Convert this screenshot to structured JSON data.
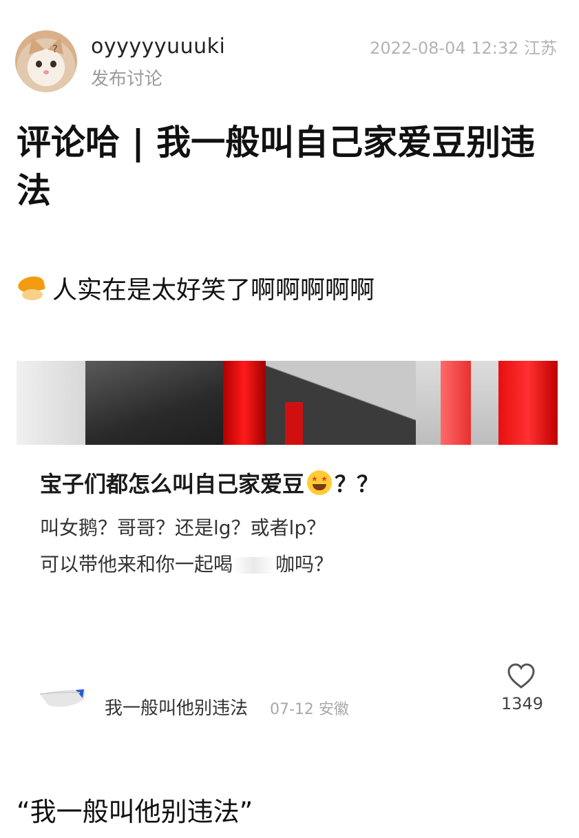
{
  "post": {
    "username": "oyyyyyuuuki",
    "subtitle": "发布讨论",
    "datetime_location": "2022-08-04 12:32 江苏",
    "title": "评论哈 | 我一般叫自己家爱豆别违法",
    "body": "人实在是太好笑了啊啊啊啊啊"
  },
  "screenshot": {
    "question_title": "宝子们都怎么叫自己家爱豆",
    "question_suffix": "？？",
    "line1": "叫女鹅？哥哥？还是lg？或者lp？",
    "line2": "可以带他来和你一起喝",
    "line2_end": "咖吗？",
    "comment_text": "我一般叫他别违法",
    "comment_meta": "07-12 安徽",
    "like_count": "1349"
  },
  "caption": "“我一般叫他别违法”",
  "colors": {
    "accent_red": "#e81010",
    "meta_gray": "#b3b3b3"
  }
}
